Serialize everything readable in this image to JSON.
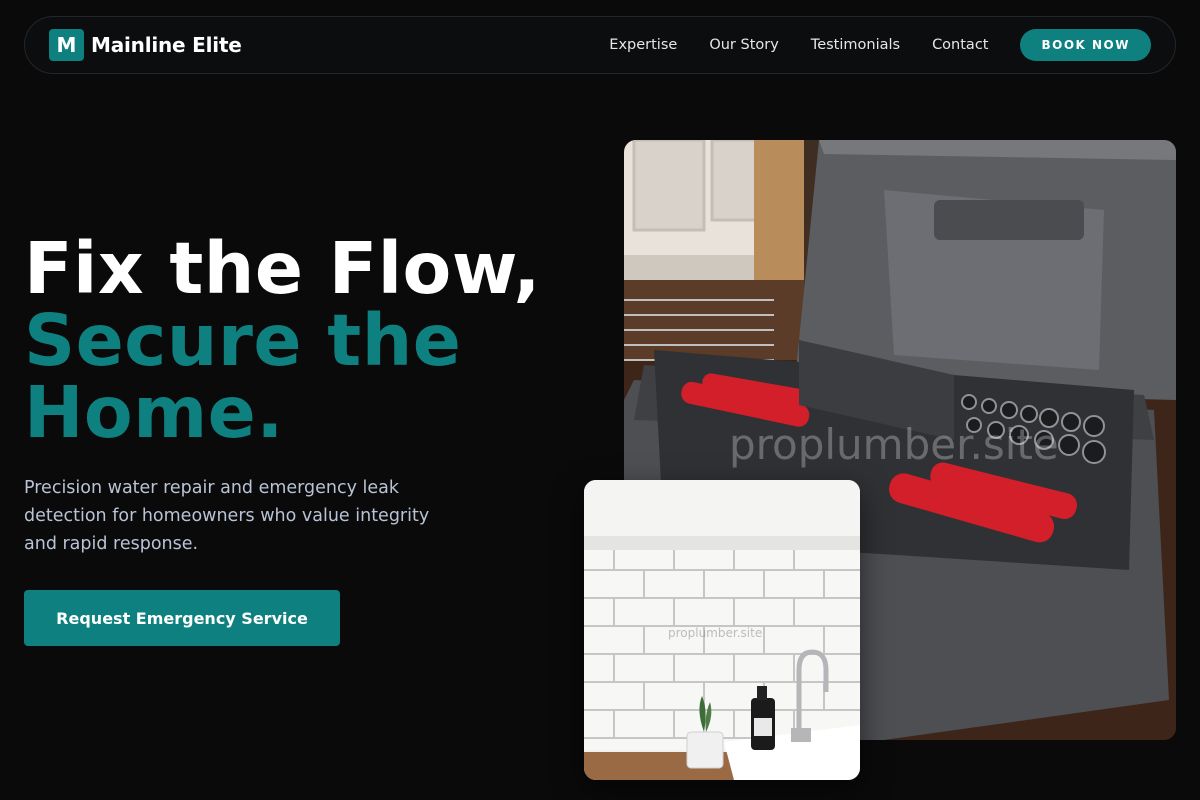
{
  "brand": {
    "logo_letter": "M",
    "name": "Mainline Elite"
  },
  "nav": {
    "links": [
      "Expertise",
      "Our Story",
      "Testimonials",
      "Contact"
    ],
    "cta_label": "BOOK NOW"
  },
  "hero": {
    "title_line1": "Fix the Flow,",
    "title_line2": "Secure the",
    "title_line3": "Home.",
    "description": "Precision water repair and emergency leak detection for homeowners who value integrity and rapid response.",
    "cta_label": "Request Emergency Service"
  },
  "images": {
    "main_watermark": "proplumber.site",
    "secondary_watermark": "proplumber.site"
  },
  "colors": {
    "accent": "#0e8080",
    "background": "#0a0a0a",
    "text_muted": "#b9c3d6"
  }
}
